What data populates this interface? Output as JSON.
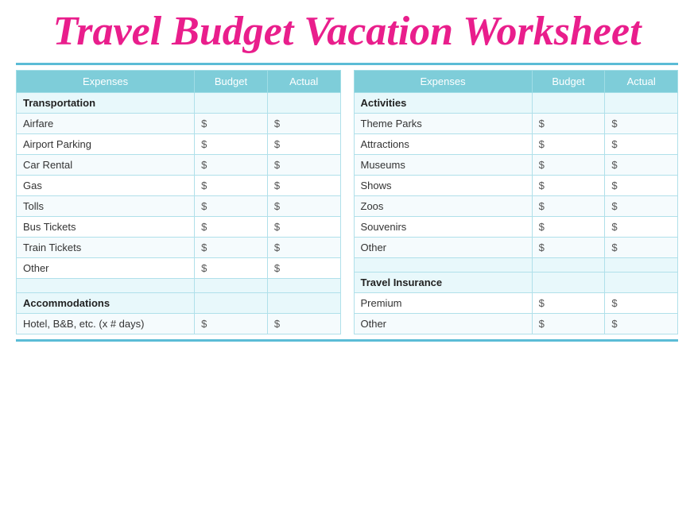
{
  "title": "Travel Budget Vacation Worksheet",
  "left_table": {
    "headers": [
      "Expenses",
      "Budget",
      "Actual"
    ],
    "sections": [
      {
        "type": "section-header",
        "label": "Transportation",
        "budget": "",
        "actual": ""
      },
      {
        "type": "data-row",
        "label": "Airfare",
        "budget": "$",
        "actual": "$"
      },
      {
        "type": "data-row",
        "label": "Airport Parking",
        "budget": "$",
        "actual": "$"
      },
      {
        "type": "data-row",
        "label": "Car Rental",
        "budget": "$",
        "actual": "$"
      },
      {
        "type": "data-row",
        "label": "Gas",
        "budget": "$",
        "actual": "$"
      },
      {
        "type": "data-row",
        "label": "Tolls",
        "budget": "$",
        "actual": "$"
      },
      {
        "type": "data-row",
        "label": "Bus Tickets",
        "budget": "$",
        "actual": "$"
      },
      {
        "type": "data-row",
        "label": "Train Tickets",
        "budget": "$",
        "actual": "$"
      },
      {
        "type": "data-row",
        "label": "Other",
        "budget": "$",
        "actual": "$"
      },
      {
        "type": "empty-row",
        "label": "",
        "budget": "",
        "actual": ""
      },
      {
        "type": "section-header",
        "label": "Accommodations",
        "budget": "",
        "actual": ""
      },
      {
        "type": "data-row",
        "label": "Hotel, B&B, etc. (x # days)",
        "budget": "$",
        "actual": "$"
      }
    ]
  },
  "right_table": {
    "headers": [
      "Expenses",
      "Budget",
      "Actual"
    ],
    "sections": [
      {
        "type": "section-header",
        "label": "Activities",
        "budget": "",
        "actual": ""
      },
      {
        "type": "data-row",
        "label": "Theme Parks",
        "budget": "$",
        "actual": "$"
      },
      {
        "type": "data-row",
        "label": "Attractions",
        "budget": "$",
        "actual": "$"
      },
      {
        "type": "data-row",
        "label": "Museums",
        "budget": "$",
        "actual": "$"
      },
      {
        "type": "data-row",
        "label": "Shows",
        "budget": "$",
        "actual": "$"
      },
      {
        "type": "data-row",
        "label": "Zoos",
        "budget": "$",
        "actual": "$"
      },
      {
        "type": "data-row",
        "label": "Souvenirs",
        "budget": "$",
        "actual": "$"
      },
      {
        "type": "data-row",
        "label": "Other",
        "budget": "$",
        "actual": "$"
      },
      {
        "type": "empty-row",
        "label": "",
        "budget": "",
        "actual": ""
      },
      {
        "type": "section-header",
        "label": "Travel Insurance",
        "budget": "",
        "actual": ""
      },
      {
        "type": "data-row",
        "label": "Premium",
        "budget": "$",
        "actual": "$"
      },
      {
        "type": "data-row",
        "label": "Other",
        "budget": "$",
        "actual": "$"
      }
    ]
  }
}
